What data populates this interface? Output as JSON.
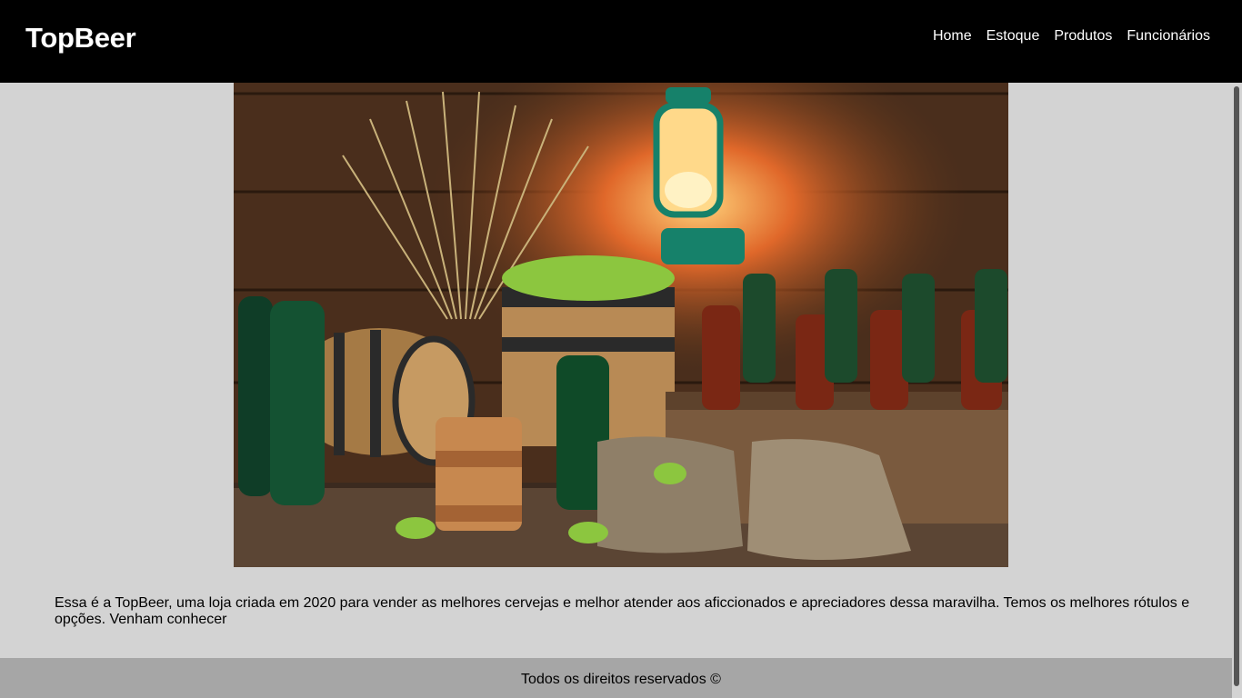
{
  "header": {
    "brand": "TopBeer",
    "nav": [
      "Home",
      "Estoque",
      "Produtos",
      "Funcionários"
    ]
  },
  "hero": {
    "image_name": "beer-still-life-image"
  },
  "main": {
    "intro_text": "Essa é a TopBeer, uma loja criada em 2020 para vender as melhores cervejas e melhor atender aos aficcionados e apreciadores dessa maravilha. Temos os melhores rótulos e opções. Venham conhecer"
  },
  "footer": {
    "copyright": "Todos os direitos reservados ©"
  },
  "colors": {
    "navbar": "#000000",
    "background": "#d3d3d3",
    "footer": "#a6a6a6"
  }
}
